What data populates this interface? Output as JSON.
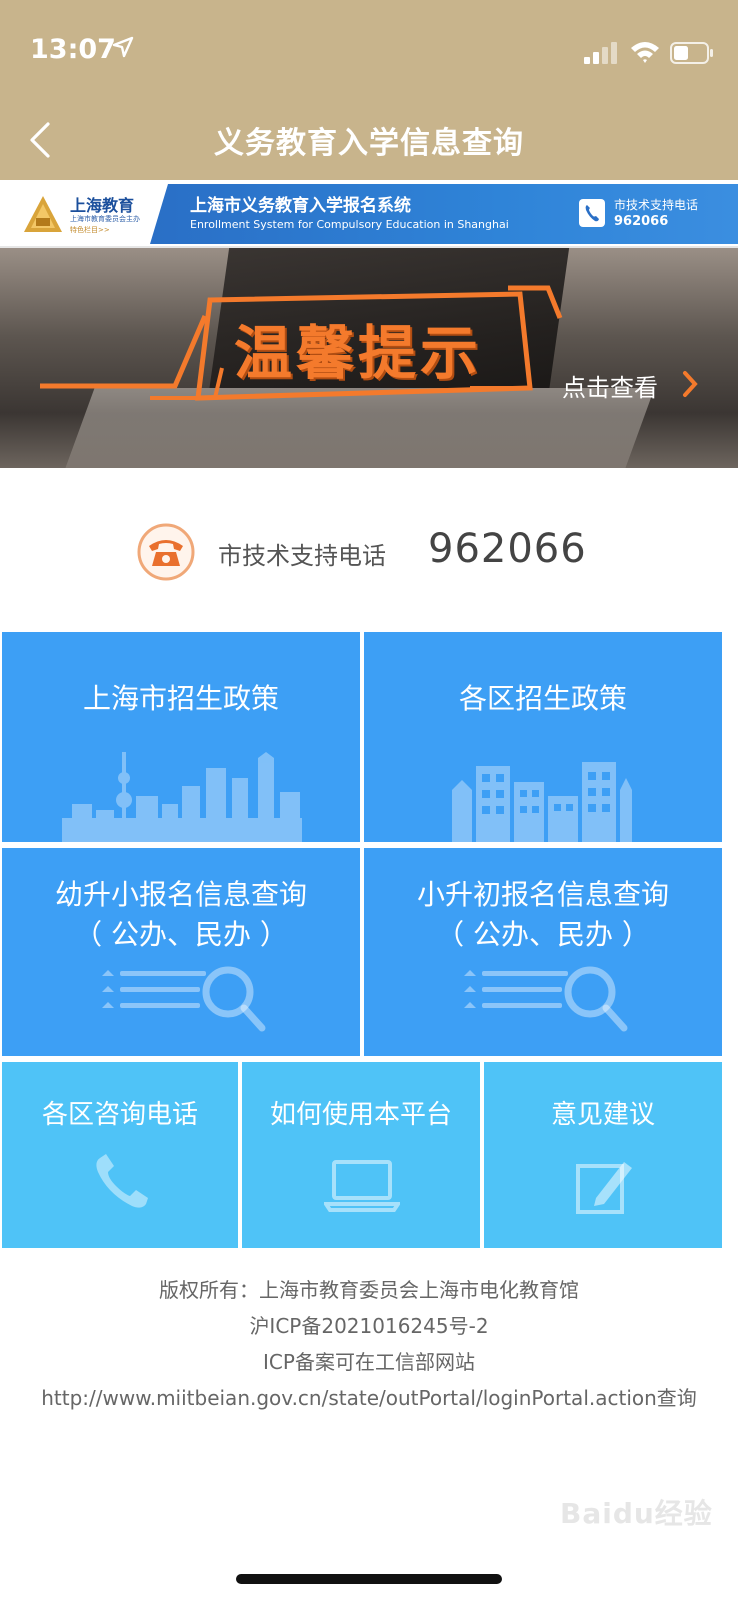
{
  "status_bar": {
    "time": "13:07"
  },
  "nav": {
    "title": "义务教育入学信息查询"
  },
  "sys_banner": {
    "logo_title": "上海教育",
    "logo_sub": "上海市教育委员会主办",
    "logo_sub2": "特色栏目>>",
    "title_cn": "上海市义务教育入学报名系统",
    "title_en": "Enrollment System for Compulsory Education in Shanghai",
    "tel_label": "市技术支持电话",
    "tel_number": "962066"
  },
  "hero": {
    "title": "温馨提示",
    "link": "点击查看"
  },
  "hotline": {
    "label": "市技术支持电话",
    "number": "962066"
  },
  "tiles": {
    "sh_policy": "上海市招生政策",
    "district_policy": "各区招生政策",
    "primary_query": {
      "line1": "幼升小报名信息查询",
      "line2": "（ 公办、民办 ）"
    },
    "middle_query": {
      "line1": "小升初报名信息查询",
      "line2": "（ 公办、民办 ）"
    },
    "district_phone": "各区咨询电话",
    "how_to_use": "如何使用本平台",
    "feedback": "意见建议"
  },
  "footer": {
    "line1": "版权所有：上海市教育委员会上海市电化教育馆",
    "line2": "沪ICP备2021016245号-2",
    "line3": "ICP备案可在工信部网站",
    "line4": "http://www.miitbeian.gov.cn/state/outPortal/loginPortal.action查询"
  },
  "watermark": "Baidu经验",
  "colors": {
    "header_bg": "#c8b48c",
    "tile_blue": "#3d9ff5",
    "tile_cyan": "#4fc3f7",
    "accent_orange": "#f47a2c",
    "system_banner_blue": "#2a6fc6"
  },
  "icons": [
    "location-arrow-icon",
    "signal-icon",
    "wifi-icon",
    "battery-icon",
    "back-chevron-icon",
    "telephone-icon",
    "handset-icon",
    "laptop-icon",
    "edit-icon",
    "search-list-icon",
    "skyline-icon",
    "buildings-icon"
  ]
}
